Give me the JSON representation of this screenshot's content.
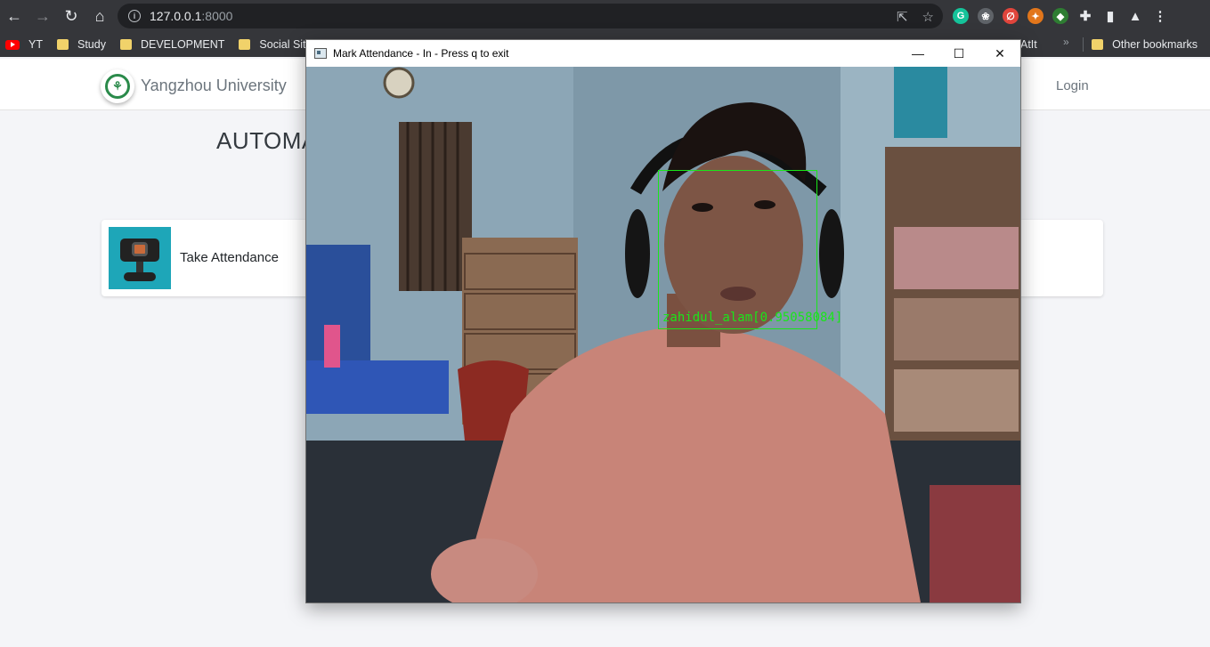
{
  "browser": {
    "url_host": "127.0.0.1",
    "url_port": ":8000",
    "bookmarks": [
      "YT",
      "Study",
      "DEVELOPMENT",
      "Social Site"
    ],
    "bookmark_partial": "AtIt",
    "other_bookmarks": "Other bookmarks",
    "extensions": [
      {
        "name": "grammarly-icon",
        "color": "#15c39a",
        "glyph": "G"
      },
      {
        "name": "extension-icon-2",
        "color": "#5f6368",
        "glyph": "❀"
      },
      {
        "name": "extension-icon-3",
        "color": "#e0453c",
        "glyph": "∅"
      },
      {
        "name": "metamask-icon",
        "color": "#e2761b",
        "glyph": "✦"
      },
      {
        "name": "extension-icon-5",
        "color": "#2e7d32",
        "glyph": "◆"
      }
    ]
  },
  "site": {
    "brand": "Yangzhou University",
    "login": "Login",
    "heading": "AUTOMA",
    "card_title": "Take Attendance"
  },
  "cv_window": {
    "title": "Mark Attendance - In - Press q to exit",
    "face_label": "zahidul_alam[0.95058084]"
  },
  "colors": {
    "detection": "#19e619",
    "card_image_bg": "#1ea6b8"
  }
}
